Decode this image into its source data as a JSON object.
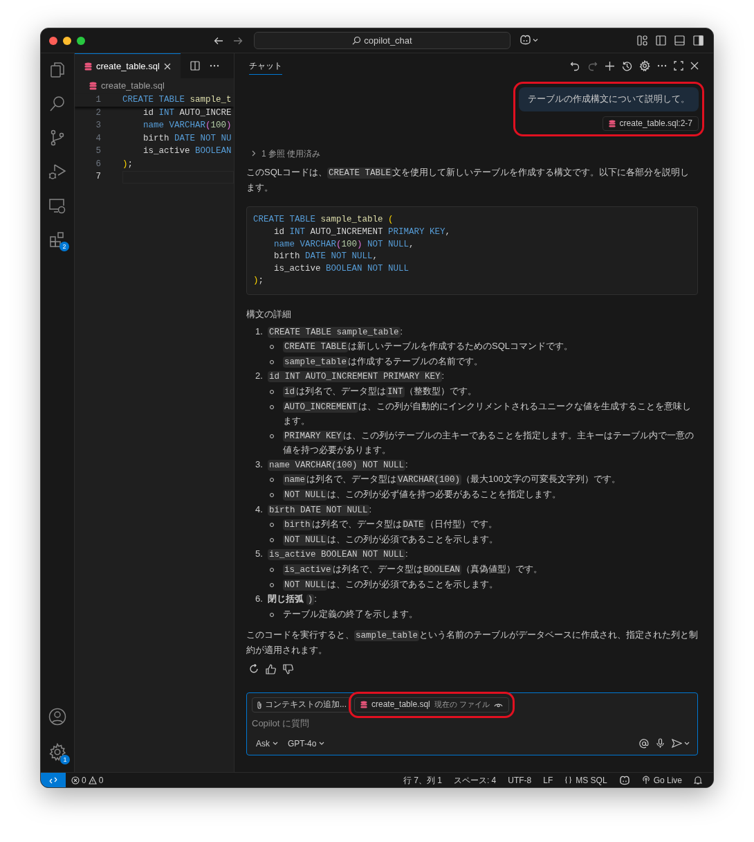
{
  "window": {
    "title": "copilot_chat"
  },
  "activity_bar": {
    "items": [
      {
        "kind": "files"
      },
      {
        "kind": "search"
      },
      {
        "kind": "source-control"
      },
      {
        "kind": "run-debug"
      },
      {
        "kind": "remote"
      },
      {
        "kind": "extensions",
        "badge": "2"
      }
    ],
    "bottom_items": [
      {
        "kind": "account"
      },
      {
        "kind": "settings",
        "badge": "1"
      }
    ]
  },
  "editor": {
    "tab": {
      "label": "create_table.sql",
      "selected": true
    },
    "breadcrumb": "create_table.sql",
    "lines": [
      {
        "number": "1",
        "current": false,
        "tokens": [
          {
            "text": "CREATE TABLE ",
            "kind": "kw"
          },
          {
            "text": "sample_t",
            "kind": "fn"
          }
        ]
      },
      {
        "number": "2",
        "current": false,
        "tokens": [
          {
            "text": "    id ",
            "kind": "plain"
          },
          {
            "text": "INT ",
            "kind": "kw"
          },
          {
            "text": "AUTO_INCRE",
            "kind": "plain"
          }
        ]
      },
      {
        "number": "3",
        "current": false,
        "tokens": [
          {
            "text": "    name VARCHAR",
            "kind": "kw"
          },
          {
            "text": "(",
            "kind": "paren2"
          },
          {
            "text": "100",
            "kind": "num"
          },
          {
            "text": ")",
            "kind": "paren2"
          }
        ]
      },
      {
        "number": "4",
        "current": false,
        "tokens": [
          {
            "text": "    birth ",
            "kind": "plain"
          },
          {
            "text": "DATE NOT NU",
            "kind": "kw"
          }
        ]
      },
      {
        "number": "5",
        "current": false,
        "tokens": [
          {
            "text": "    is_active ",
            "kind": "plain"
          },
          {
            "text": "BOOLEAN",
            "kind": "kw"
          }
        ]
      },
      {
        "number": "6",
        "current": false,
        "tokens": [
          {
            "text": ")",
            "kind": "paren"
          },
          {
            "text": ";",
            "kind": "plain"
          }
        ]
      },
      {
        "number": "7",
        "current": true
      }
    ]
  },
  "chat": {
    "tab": {
      "label": "チャット",
      "selected": true
    },
    "user_message": {
      "text": "テーブルの作成構文について説明して。",
      "reference": "create_table.sql:2-7",
      "highlighted": true
    },
    "references": "1 参照 使用済み",
    "intro": [
      {
        "kind": "text",
        "text": "このSQLコードは、"
      },
      {
        "kind": "code",
        "text": "CREATE TABLE"
      },
      {
        "kind": "text",
        "text": "文を使用して新しいテーブルを作成する構文です。以下に各部分を説明します。"
      }
    ],
    "code_block": [
      [
        {
          "text": "CREATE TABLE ",
          "kind": "kw"
        },
        {
          "text": "sample_table ",
          "kind": "fn"
        },
        {
          "text": "(",
          "kind": "paren"
        }
      ],
      [
        {
          "text": "    id ",
          "kind": "plain"
        },
        {
          "text": "INT ",
          "kind": "kw"
        },
        {
          "text": "AUTO_INCREMENT ",
          "kind": "plain"
        },
        {
          "text": "PRIMARY KEY",
          "kind": "kw"
        },
        {
          "text": ",",
          "kind": "plain"
        }
      ],
      [
        {
          "text": "    name VARCHAR",
          "kind": "kw"
        },
        {
          "text": "(",
          "kind": "paren2"
        },
        {
          "text": "100",
          "kind": "num"
        },
        {
          "text": ") ",
          "kind": "paren2"
        },
        {
          "text": "NOT NULL",
          "kind": "kw"
        },
        {
          "text": ",",
          "kind": "plain"
        }
      ],
      [
        {
          "text": "    birth ",
          "kind": "plain"
        },
        {
          "text": "DATE NOT NULL",
          "kind": "kw"
        },
        {
          "text": ",",
          "kind": "plain"
        }
      ],
      [
        {
          "text": "    is_active ",
          "kind": "plain"
        },
        {
          "text": "BOOLEAN NOT NULL",
          "kind": "kw"
        }
      ],
      [
        {
          "text": ")",
          "kind": "paren"
        },
        {
          "text": ";",
          "kind": "plain"
        }
      ]
    ],
    "heading": "構文の詳細",
    "list": [
      {
        "number": "1.",
        "label": [
          {
            "kind": "code",
            "text": "CREATE TABLE sample_table"
          },
          {
            "kind": "text",
            "text": ":"
          }
        ],
        "bullets": [
          [
            {
              "kind": "code",
              "text": "CREATE TABLE"
            },
            {
              "kind": "text",
              "text": "は新しいテーブルを作成するためのSQLコマンドです。"
            }
          ],
          [
            {
              "kind": "code",
              "text": "sample_table"
            },
            {
              "kind": "text",
              "text": "は作成するテーブルの名前です。"
            }
          ]
        ]
      },
      {
        "number": "2.",
        "label": [
          {
            "kind": "code",
            "text": "id INT AUTO_INCREMENT PRIMARY KEY"
          },
          {
            "kind": "text",
            "text": ":"
          }
        ],
        "bullets": [
          [
            {
              "kind": "code",
              "text": "id"
            },
            {
              "kind": "text",
              "text": "は列名で、データ型は"
            },
            {
              "kind": "code",
              "text": "INT"
            },
            {
              "kind": "text",
              "text": "（整数型）です。"
            }
          ],
          [
            {
              "kind": "code",
              "text": "AUTO_INCREMENT"
            },
            {
              "kind": "text",
              "text": "は、この列が自動的にインクリメントされるユニークな値を生成することを意味します。"
            }
          ],
          [
            {
              "kind": "code",
              "text": "PRIMARY KEY"
            },
            {
              "kind": "text",
              "text": "は、この列がテーブルの主キーであることを指定します。主キーはテーブル内で一意の値を持つ必要があります。"
            }
          ]
        ]
      },
      {
        "number": "3.",
        "label": [
          {
            "kind": "code",
            "text": "name VARCHAR(100) NOT NULL"
          },
          {
            "kind": "text",
            "text": ":"
          }
        ],
        "bullets": [
          [
            {
              "kind": "code",
              "text": "name"
            },
            {
              "kind": "text",
              "text": "は列名で、データ型は"
            },
            {
              "kind": "code",
              "text": "VARCHAR(100)"
            },
            {
              "kind": "text",
              "text": "（最大100文字の可変長文字列）です。"
            }
          ],
          [
            {
              "kind": "code",
              "text": "NOT NULL"
            },
            {
              "kind": "text",
              "text": "は、この列が必ず値を持つ必要があることを指定します。"
            }
          ]
        ]
      },
      {
        "number": "4.",
        "label": [
          {
            "kind": "code",
            "text": "birth DATE NOT NULL"
          },
          {
            "kind": "text",
            "text": ":"
          }
        ],
        "bullets": [
          [
            {
              "kind": "code",
              "text": "birth"
            },
            {
              "kind": "text",
              "text": "は列名で、データ型は"
            },
            {
              "kind": "code",
              "text": "DATE"
            },
            {
              "kind": "text",
              "text": "（日付型）です。"
            }
          ],
          [
            {
              "kind": "code",
              "text": "NOT NULL"
            },
            {
              "kind": "text",
              "text": "は、この列が必須であることを示します。"
            }
          ]
        ]
      },
      {
        "number": "5.",
        "label": [
          {
            "kind": "code",
            "text": "is_active BOOLEAN NOT NULL"
          },
          {
            "kind": "text",
            "text": ":"
          }
        ],
        "bullets": [
          [
            {
              "kind": "code",
              "text": "is_active"
            },
            {
              "kind": "text",
              "text": "は列名で、データ型は"
            },
            {
              "kind": "code",
              "text": "BOOLEAN"
            },
            {
              "kind": "text",
              "text": "（真偽値型）です。"
            }
          ],
          [
            {
              "kind": "code",
              "text": "NOT NULL"
            },
            {
              "kind": "text",
              "text": "は、この列が必須であることを示します。"
            }
          ]
        ]
      },
      {
        "number": "6.",
        "label": [
          {
            "kind": "bold",
            "text": "閉じ括弧 "
          },
          {
            "kind": "code",
            "text": ")"
          },
          {
            "kind": "text",
            "text": ":"
          }
        ],
        "bullets": [
          [
            {
              "kind": "text",
              "text": "テーブル定義の終了を示します。"
            }
          ]
        ]
      }
    ],
    "closing": [
      {
        "kind": "text",
        "text": "このコードを実行すると、"
      },
      {
        "kind": "code",
        "text": "sample_table"
      },
      {
        "kind": "text",
        "text": "という名前のテーブルがデータベースに作成され、指定された列と制約が適用されます。"
      }
    ],
    "input": {
      "context_button": "コンテキストの追加...",
      "file_chip": {
        "name": "create_table.sql",
        "note": "現在の ファイル",
        "highlighted": true
      },
      "placeholder": "Copilot に質問",
      "mode": "Ask",
      "model": "GPT-4o"
    }
  },
  "status_bar": {
    "errors": "0",
    "warnings": "0",
    "items": [
      {
        "kind": "text",
        "text": "行 7、列 1"
      },
      {
        "kind": "text",
        "text": "スペース: 4"
      },
      {
        "kind": "text",
        "text": "UTF-8"
      },
      {
        "kind": "text",
        "text": "LF"
      },
      {
        "kind": "braces",
        "text": "MS SQL"
      },
      {
        "kind": "copilot"
      },
      {
        "kind": "broadcast",
        "text": "Go Live"
      },
      {
        "kind": "bell"
      }
    ]
  }
}
